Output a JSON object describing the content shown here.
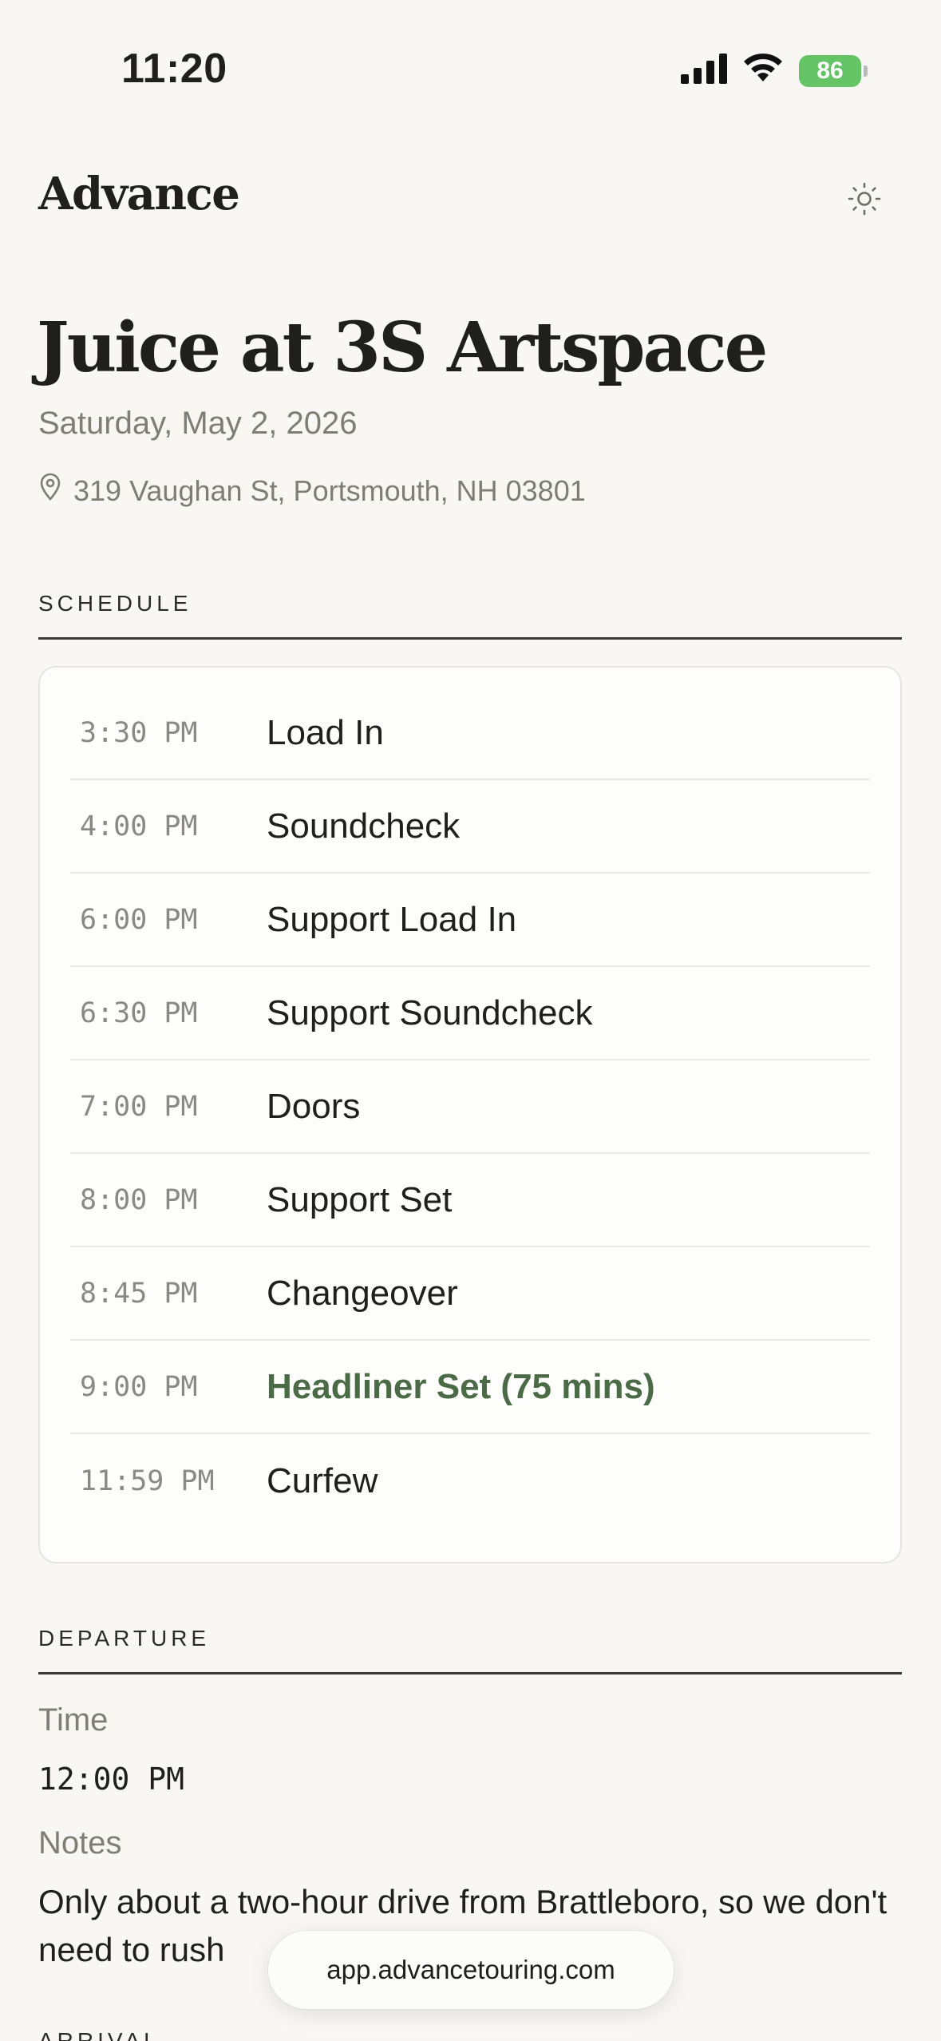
{
  "status_bar": {
    "time": "11:20",
    "battery": "86",
    "icons": [
      "cellular-signal-icon",
      "wifi-icon",
      "battery-charging-icon"
    ]
  },
  "header": {
    "brand": "Advance",
    "theme_icon": "sun-icon"
  },
  "event": {
    "title": "Juice at 3S Artspace",
    "date": "Saturday, May 2, 2026",
    "address": "319 Vaughan St, Portsmouth, NH 03801",
    "address_icon": "map-pin-icon"
  },
  "schedule": {
    "label": "SCHEDULE",
    "items": [
      {
        "time": "3:30 PM",
        "label": "Load In"
      },
      {
        "time": "4:00 PM",
        "label": "Soundcheck"
      },
      {
        "time": "6:00 PM",
        "label": "Support Load In"
      },
      {
        "time": "6:30 PM",
        "label": "Support Soundcheck"
      },
      {
        "time": "7:00 PM",
        "label": "Doors"
      },
      {
        "time": "8:00 PM",
        "label": "Support Set"
      },
      {
        "time": "8:45 PM",
        "label": "Changeover"
      },
      {
        "time": "9:00 PM",
        "label": "Headliner Set (75 mins)",
        "highlight": true
      },
      {
        "time": "11:59 PM",
        "label": "Curfew"
      }
    ]
  },
  "departure": {
    "label": "DEPARTURE",
    "time_label": "Time",
    "time_value": "12:00 PM",
    "notes_label": "Notes",
    "notes_value": "Only about a two-hour drive from Brattleboro, so we don't need to rush"
  },
  "next_section": {
    "label": "ARRIVAL"
  },
  "browser": {
    "url": "app.advancetouring.com"
  },
  "colors": {
    "background": "#f8f7f4",
    "text": "#1f1f1c",
    "muted": "#807d77",
    "accent_green": "#4a6b45",
    "battery_green": "#65c466"
  }
}
